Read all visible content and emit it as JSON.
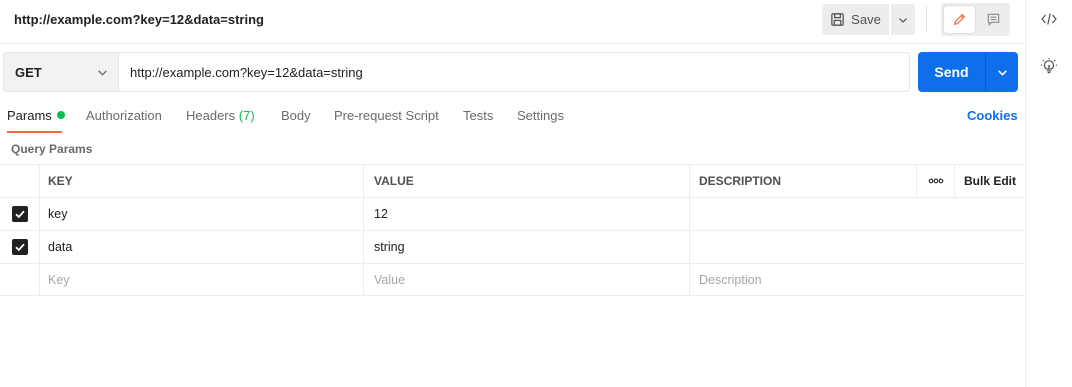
{
  "title_bar": {
    "title": "http://example.com?key=12&data=string",
    "save_label": "Save"
  },
  "request": {
    "method": "GET",
    "url": "http://example.com?key=12&data=string",
    "send_label": "Send"
  },
  "tabs": {
    "params": "Params",
    "authorization": "Authorization",
    "headers": "Headers",
    "headers_count": "(7)",
    "body": "Body",
    "pre_request": "Pre-request Script",
    "tests": "Tests",
    "settings": "Settings",
    "cookies": "Cookies"
  },
  "query_params": {
    "label": "Query Params",
    "columns": {
      "key": "KEY",
      "value": "VALUE",
      "description": "DESCRIPTION",
      "more": "ooo",
      "bulk_edit": "Bulk Edit"
    },
    "rows": [
      {
        "key": "key",
        "value": "12",
        "description": "",
        "checked": true
      },
      {
        "key": "data",
        "value": "string",
        "description": "",
        "checked": true
      }
    ],
    "placeholders": {
      "key": "Key",
      "value": "Value",
      "description": "Description"
    }
  },
  "colors": {
    "accent_blue": "#0d6fea",
    "active_tab_underline": "#f26b3a",
    "status_green": "#0cbb52"
  },
  "icons": {
    "save": "save-icon",
    "edit": "pencil-icon",
    "comments": "comment-icon",
    "code": "code-icon",
    "lightbulb": "lightbulb-icon"
  }
}
